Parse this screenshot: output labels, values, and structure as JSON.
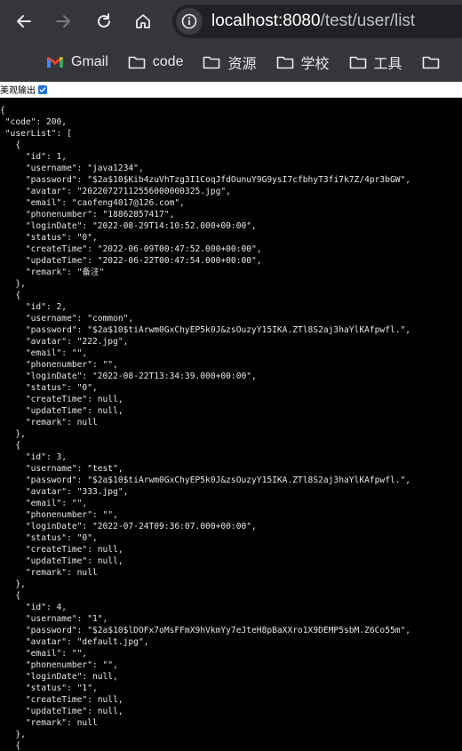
{
  "browser": {
    "url_host": "localhost:8080",
    "url_path": "/test/user/list"
  },
  "bookmarks": [
    {
      "label": "Gmail",
      "icon": "gmail-icon"
    },
    {
      "label": "code",
      "icon": "folder-icon"
    },
    {
      "label": "资源",
      "icon": "folder-icon"
    },
    {
      "label": "学校",
      "icon": "folder-icon"
    },
    {
      "label": "工具",
      "icon": "folder-icon"
    }
  ],
  "pretty_print": {
    "label": "美观输出",
    "checked": true
  },
  "json_lines": [
    "{",
    " \"code\": 200,",
    " \"userList\": [",
    "   {",
    "     \"id\": 1,",
    "     \"username\": \"java1234\",",
    "     \"password\": \"$2a$10$Kib4zuVhTzg3I1CoqJfdOunuY9G9ysI7cfbhyT3fi7k7Z/4pr3bGW\",",
    "     \"avatar\": \"20220727112556000000325.jpg\",",
    "     \"email\": \"caofeng4017@126.com\",",
    "     \"phonenumber\": \"18862857417\",",
    "     \"loginDate\": \"2022-08-29T14:10:52.000+00:00\",",
    "     \"status\": \"0\",",
    "     \"createTime\": \"2022-06-09T00:47:52.000+00:00\",",
    "     \"updateTime\": \"2022-06-22T00:47:54.000+00:00\",",
    "     \"remark\": \"备注\"",
    "   },",
    "   {",
    "     \"id\": 2,",
    "     \"username\": \"common\",",
    "     \"password\": \"$2a$10$tiArwm0GxChyEP5k0J&zsOuzyY15IKA.ZTl8S2aj3haYlKAfpwfl.\",",
    "     \"avatar\": \"222.jpg\",",
    "     \"email\": \"\",",
    "     \"phonenumber\": \"\",",
    "     \"loginDate\": \"2022-08-22T13:34:39.000+00:00\",",
    "     \"status\": \"0\",",
    "     \"createTime\": null,",
    "     \"updateTime\": null,",
    "     \"remark\": null",
    "   },",
    "   {",
    "     \"id\": 3,",
    "     \"username\": \"test\",",
    "     \"password\": \"$2a$10$tiArwm0GxChyEP5k0J&zsOuzyY15IKA.ZTl8S2aj3haYlKAfpwfl.\",",
    "     \"avatar\": \"333.jpg\",",
    "     \"email\": \"\",",
    "     \"phonenumber\": \"\",",
    "     \"loginDate\": \"2022-07-24T09:36:07.000+00:00\",",
    "     \"status\": \"0\",",
    "     \"createTime\": null,",
    "     \"updateTime\": null,",
    "     \"remark\": null",
    "   },",
    "   {",
    "     \"id\": 4,",
    "     \"username\": \"1\",",
    "     \"password\": \"$2a$10$lDOFx7oMsFFmX9hVkmYy7eJteH8pBaXXro1X9DEMP5sbM.Z6Co55m\",",
    "     \"avatar\": \"default.jpg\",",
    "     \"email\": \"\",",
    "     \"phonenumber\": \"\",",
    "     \"loginDate\": null,",
    "     \"status\": \"1\",",
    "     \"createTime\": null,",
    "     \"updateTime\": null,",
    "     \"remark\": null",
    "   },",
    "   {"
  ]
}
